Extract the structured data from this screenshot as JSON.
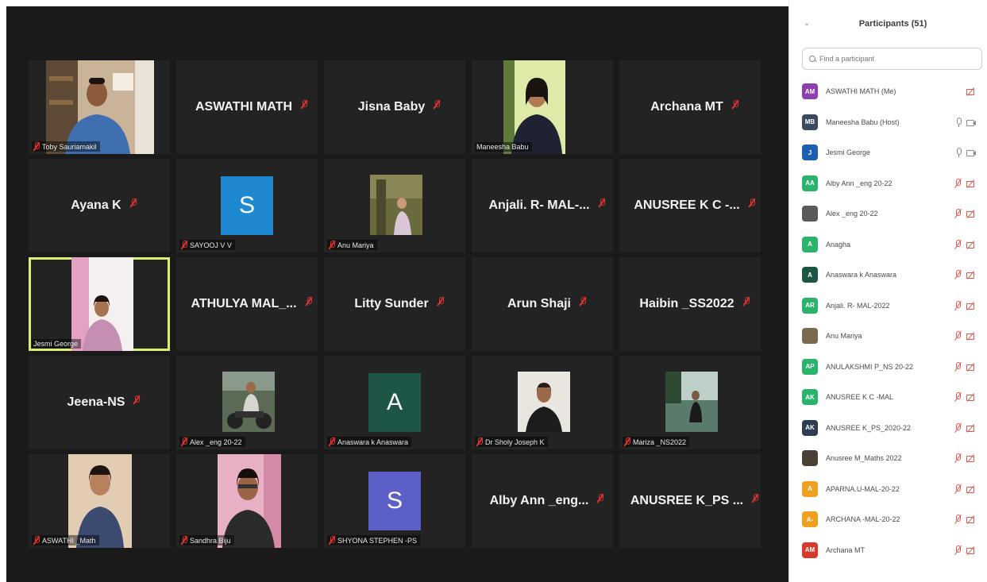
{
  "participants_panel": {
    "title": "Participants (51)",
    "search_placeholder": "Find a participant",
    "participants": [
      {
        "initials": "AM",
        "name": "ASWATHI MATH (Me)",
        "color": "#8e3fae",
        "mic": "none",
        "cam": "off"
      },
      {
        "initials": "MB",
        "name": "Maneesha Babu (Host)",
        "color": "#3b4a5c",
        "mic": "on",
        "cam": "on"
      },
      {
        "initials": "J",
        "name": "Jesmi George",
        "color": "#1f5fb0",
        "mic": "on",
        "cam": "on"
      },
      {
        "initials": "AA",
        "name": "Alby Ann _eng 20-22",
        "color": "#2bb36b",
        "mic": "off",
        "cam": "off"
      },
      {
        "initials": "",
        "name": "Alex _eng 20-22",
        "color": "#5a5a5a",
        "mic": "off",
        "cam": "off"
      },
      {
        "initials": "A",
        "name": "Anagha",
        "color": "#2bb36b",
        "mic": "off",
        "cam": "off"
      },
      {
        "initials": "A",
        "name": "Anaswara k Anaswara",
        "color": "#1d5646",
        "mic": "off",
        "cam": "off"
      },
      {
        "initials": "AR",
        "name": "Anjali. R- MAL-2022",
        "color": "#2bb36b",
        "mic": "off",
        "cam": "off"
      },
      {
        "initials": "",
        "name": "Anu Mariya",
        "color": "#7a6a4f",
        "mic": "off",
        "cam": "off"
      },
      {
        "initials": "AP",
        "name": "ANULAKSHMI P_NS 20-22",
        "color": "#2bb36b",
        "mic": "off",
        "cam": "off"
      },
      {
        "initials": "AK",
        "name": "ANUSREE K C -MAL",
        "color": "#2bb36b",
        "mic": "off",
        "cam": "off"
      },
      {
        "initials": "AK",
        "name": "ANUSREE K_PS_2020-22",
        "color": "#2f3d52",
        "mic": "off",
        "cam": "off"
      },
      {
        "initials": "",
        "name": "Anusree M_Maths 2022",
        "color": "#4a4036",
        "mic": "off",
        "cam": "off"
      },
      {
        "initials": "A",
        "name": "APARNA.U-MAL-20-22",
        "color": "#f0a020",
        "mic": "off",
        "cam": "off"
      },
      {
        "initials": "A-",
        "name": "ARCHANA -MAL-20-22",
        "color": "#f0a020",
        "mic": "off",
        "cam": "off"
      },
      {
        "initials": "AM",
        "name": "Archana MT",
        "color": "#d8392b",
        "mic": "off",
        "cam": "off"
      }
    ]
  },
  "gallery": {
    "tiles": [
      {
        "type": "video",
        "label": "Toby Sauriamakil"
      },
      {
        "type": "name",
        "name": "ASWATHI MATH"
      },
      {
        "type": "name",
        "name": "Jisna Baby"
      },
      {
        "type": "video",
        "label": "Maneesha Babu"
      },
      {
        "type": "name",
        "name": "Archana MT"
      },
      {
        "type": "name",
        "name": "Ayana K"
      },
      {
        "type": "avatar",
        "letter": "S",
        "color": "#1e88d0",
        "label": "SAYOOJ V V"
      },
      {
        "type": "video",
        "label": "Anu Mariya"
      },
      {
        "type": "name",
        "name": "Anjali. R- MAL-..."
      },
      {
        "type": "name",
        "name": "ANUSREE K C -..."
      },
      {
        "type": "video",
        "label": "Jesmi George",
        "active": true
      },
      {
        "type": "name",
        "name": "ATHULYA MAL_..."
      },
      {
        "type": "name",
        "name": "Litty Sunder"
      },
      {
        "type": "name",
        "name": "Arun Shaji"
      },
      {
        "type": "name",
        "name": "Haibin _SS2022"
      },
      {
        "type": "name",
        "name": "Jeena-NS"
      },
      {
        "type": "video",
        "label": "Alex _eng 20-22"
      },
      {
        "type": "avatar",
        "letter": "A",
        "color": "#1d5646",
        "label": "Anaswara k Anaswara"
      },
      {
        "type": "video",
        "label": "Dr Sholy Joseph K"
      },
      {
        "type": "video",
        "label": "Mariza _NS2022"
      },
      {
        "type": "video",
        "label": "ASWATHI _Math"
      },
      {
        "type": "video",
        "label": "Sandhra Biju"
      },
      {
        "type": "avatar",
        "letter": "S",
        "color": "#5b5fc7",
        "label": "SHYONA STEPHEN -PS"
      },
      {
        "type": "name",
        "name": "Alby Ann _eng..."
      },
      {
        "type": "name",
        "name": "ANUSREE K_PS ..."
      }
    ]
  }
}
